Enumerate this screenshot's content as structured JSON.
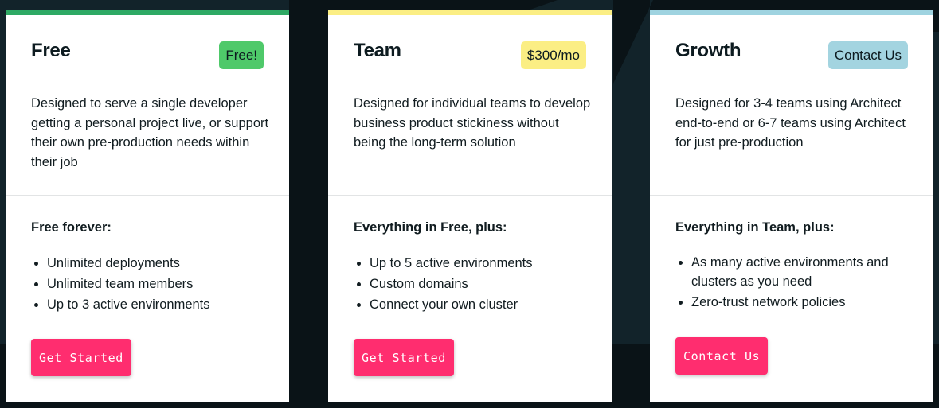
{
  "colors": {
    "page_bg": "#0a1317",
    "band_bg": "#12232a",
    "cta": "#ff2d6f",
    "free_accent": "#2ea964",
    "free_badge": "#4fc96a",
    "team_accent": "#fbee84",
    "team_badge": "#fbee84",
    "growth_accent": "#9fd3e0",
    "growth_badge": "#a3d4e0"
  },
  "plans": [
    {
      "name": "Free",
      "badge": "Free!",
      "description": "Designed to serve a single developer getting a personal project live, or support their own pre-production needs within their job",
      "features_heading": "Free forever:",
      "features": [
        "Unlimited deployments",
        "Unlimited team members",
        "Up to 3 active environments"
      ],
      "cta": "Get Started"
    },
    {
      "name": "Team",
      "badge": "$300/mo",
      "description": "Designed for individual teams to develop business product stickiness without being the long-term solution",
      "features_heading": "Everything in Free, plus:",
      "features": [
        "Up to 5 active environments",
        "Custom domains",
        "Connect your own cluster"
      ],
      "cta": "Get Started"
    },
    {
      "name": "Growth",
      "badge": "Contact Us",
      "description": "Designed for 3-4 teams using Architect end-to-end or 6-7 teams using Architect for just pre-production",
      "features_heading": "Everything in Team, plus:",
      "features": [
        "As many active environments and clusters as you need",
        "Zero-trust network policies"
      ],
      "cta": "Contact Us"
    }
  ]
}
